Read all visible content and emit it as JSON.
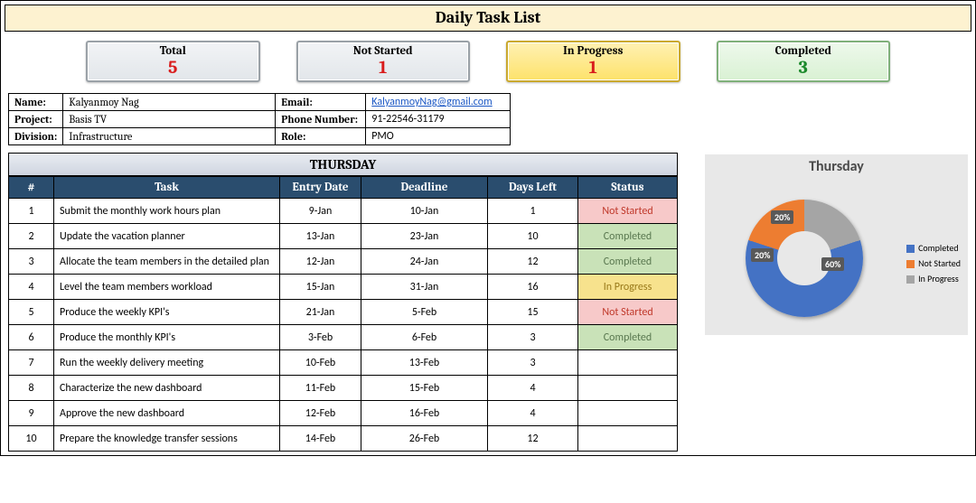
{
  "page_title": "Daily Task List",
  "summary": {
    "total": {
      "label": "Total",
      "value": "5"
    },
    "not_started": {
      "label": "Not Started",
      "value": "1"
    },
    "in_progress": {
      "label": "In Progress",
      "value": "1"
    },
    "completed": {
      "label": "Completed",
      "value": "3"
    }
  },
  "info": {
    "name_label": "Name:",
    "name": "Kalyanmoy Nag",
    "email_label": "Email:",
    "email": "KalyanmoyNag@gmail.com",
    "project_label": "Project:",
    "project": "Basis TV",
    "phone_label": "Phone Number:",
    "phone": "91-22546-31179",
    "division_label": "Division:",
    "division": "Infrastructure",
    "role_label": "Role:",
    "role": "PMO"
  },
  "day_banner": "THURSDAY",
  "columns": {
    "num": "#",
    "task": "Task",
    "entry": "Entry Date",
    "deadline": "Deadline",
    "days": "Days Left",
    "status": "Status"
  },
  "status_text": {
    "ns": "Not Started",
    "cm": "Completed",
    "ip": "In Progress"
  },
  "tasks": [
    {
      "n": "1",
      "task": "Submit the monthly work hours plan",
      "entry": "9-Jan",
      "deadline": "10-Jan",
      "days": "1",
      "status": "ns"
    },
    {
      "n": "2",
      "task": "Update the vacation planner",
      "entry": "13-Jan",
      "deadline": "23-Jan",
      "days": "10",
      "status": "cm"
    },
    {
      "n": "3",
      "task": "Allocate the team members in the detailed plan",
      "entry": "12-Jan",
      "deadline": "24-Jan",
      "days": "12",
      "status": "cm"
    },
    {
      "n": "4",
      "task": "Level the team members workload",
      "entry": "15-Jan",
      "deadline": "31-Jan",
      "days": "16",
      "status": "ip"
    },
    {
      "n": "5",
      "task": "Produce the weekly KPI's",
      "entry": "21-Jan",
      "deadline": "5-Feb",
      "days": "15",
      "status": "ns"
    },
    {
      "n": "6",
      "task": "Produce the monthly KPI's",
      "entry": "3-Feb",
      "deadline": "6-Feb",
      "days": "3",
      "status": "cm"
    },
    {
      "n": "7",
      "task": "Run the weekly delivery meeting",
      "entry": "10-Feb",
      "deadline": "13-Feb",
      "days": "3",
      "status": ""
    },
    {
      "n": "8",
      "task": "Characterize the new dashboard",
      "entry": "11-Feb",
      "deadline": "15-Feb",
      "days": "4",
      "status": ""
    },
    {
      "n": "9",
      "task": "Approve the new dashboard",
      "entry": "12-Feb",
      "deadline": "16-Feb",
      "days": "4",
      "status": ""
    },
    {
      "n": "10",
      "task": "Prepare the knowledge transfer sessions",
      "entry": "14-Feb",
      "deadline": "26-Feb",
      "days": "12",
      "status": ""
    }
  ],
  "chart_data": {
    "type": "pie",
    "title": "Thursday",
    "series": [
      {
        "name": "Completed",
        "value": 60,
        "label": "60%"
      },
      {
        "name": "Not Started",
        "value": 20,
        "label": "20%"
      },
      {
        "name": "In Progress",
        "value": 20,
        "label": "20%"
      }
    ],
    "legend": [
      "Completed",
      "Not Started",
      "In Progress"
    ]
  }
}
